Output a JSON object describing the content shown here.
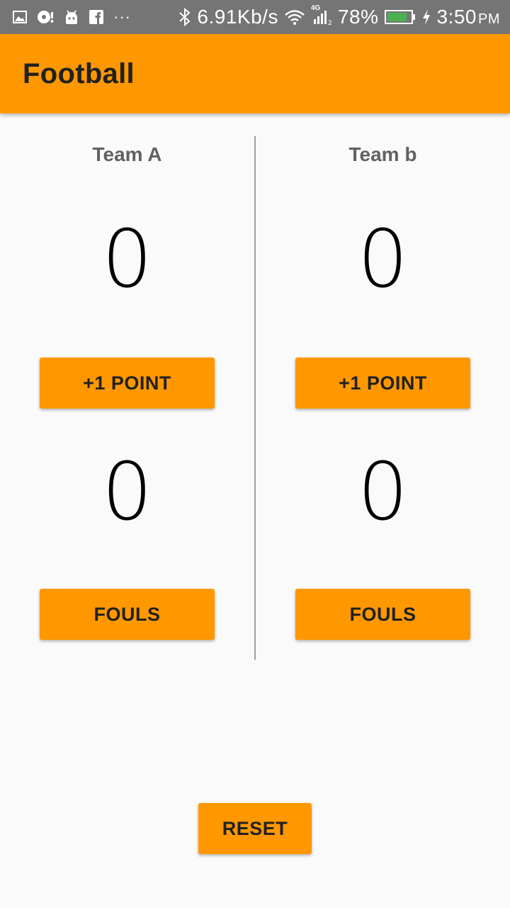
{
  "status_bar": {
    "icons_left": [
      "gallery-icon",
      "music-icon",
      "android-icon",
      "facebook-icon"
    ],
    "more": "···",
    "network_speed": "6.91Kb/s",
    "network_type": "4G",
    "battery": "78%",
    "time": "3:50",
    "am_pm": "PM",
    "colors": {
      "background": "#757575",
      "battery_fill": "#4caf50"
    }
  },
  "app_bar": {
    "title": "Football",
    "color": "#ff9800"
  },
  "team_a": {
    "name": "Team A",
    "score": "0",
    "point_button": "+1 POINT",
    "fouls": "0",
    "fouls_button": "FOULS"
  },
  "team_b": {
    "name": "Team b",
    "score": "0",
    "point_button": "+1 POINT",
    "fouls": "0",
    "fouls_button": "FOULS"
  },
  "reset_button": "RESET"
}
